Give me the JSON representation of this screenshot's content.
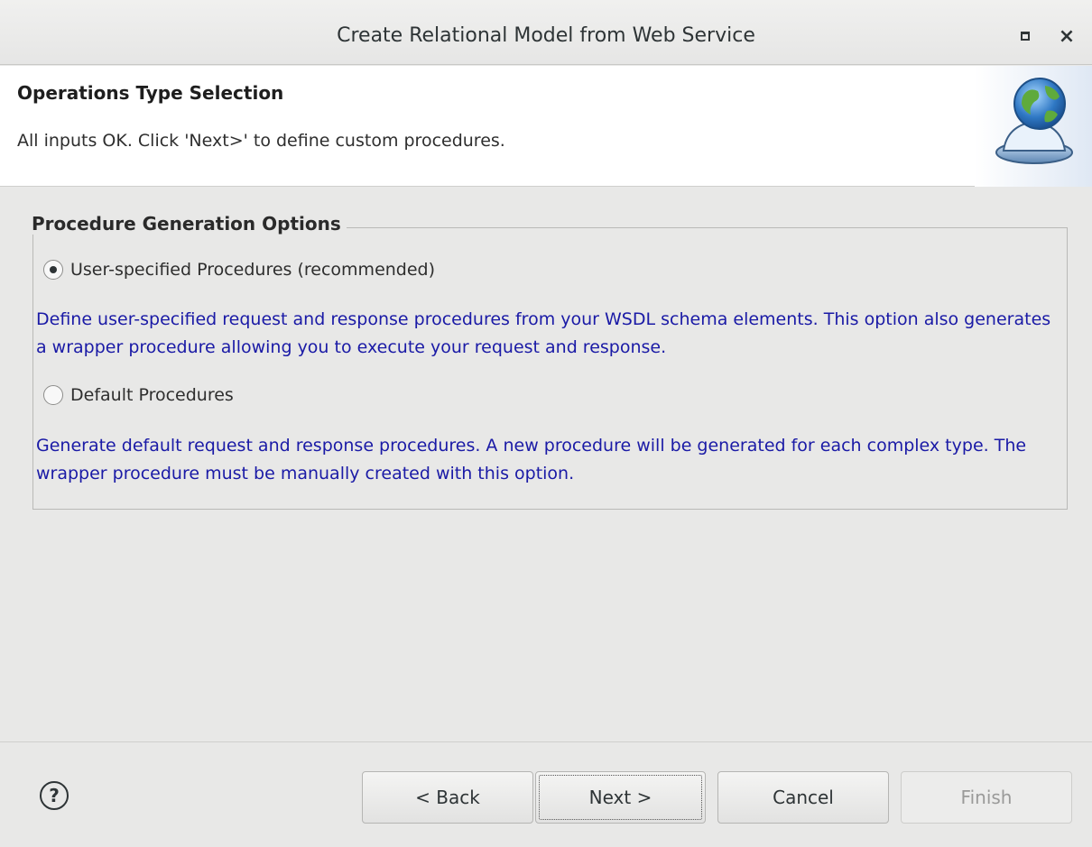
{
  "window": {
    "title": "Create Relational Model from Web Service",
    "maximize_icon": "maximize-icon",
    "close_label": "×"
  },
  "header": {
    "title": "Operations Type Selection",
    "message": "All inputs OK. Click 'Next>' to define custom procedures.",
    "icon": "globe-service-bell-icon"
  },
  "group": {
    "legend": "Procedure Generation Options",
    "options": [
      {
        "label": "User-specified Procedures (recommended)",
        "selected": true,
        "description": "Define user-specified request and response procedures from your WSDL schema elements. This option also generates a wrapper procedure allowing you to execute your request and response."
      },
      {
        "label": "Default Procedures",
        "selected": false,
        "description": "Generate default request and response procedures. A new procedure will be generated for each complex type. The wrapper procedure must be manually created with this option."
      }
    ]
  },
  "footer": {
    "help_label": "?",
    "back_label": "< Back",
    "next_label": "Next >",
    "cancel_label": "Cancel",
    "finish_label": "Finish"
  },
  "colors": {
    "description_text": "#1a1aa6",
    "background": "#e8e8e7"
  }
}
